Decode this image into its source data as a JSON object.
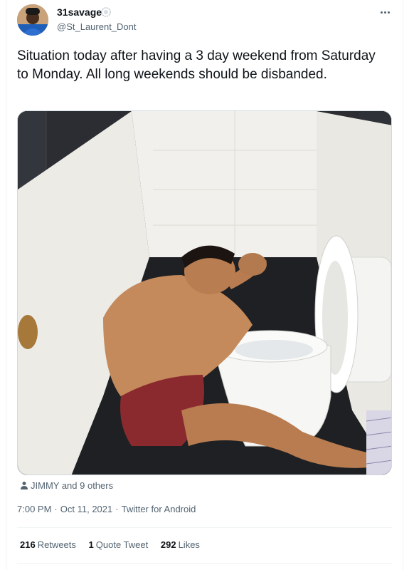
{
  "author": {
    "display_name": "31savage",
    "username": "@St_Laurent_Dont",
    "verified_icon": "badge-icon"
  },
  "tweet": {
    "text": "Situation today after having a 3 day weekend from Saturday to Monday. All long weekends should be disbanded."
  },
  "media": {
    "description_icon": "photo"
  },
  "liked_by": {
    "icon": "person-icon",
    "text": "JIMMY and 9 others"
  },
  "meta": {
    "time": "7:00 PM",
    "separator": "·",
    "date": "Oct 11, 2021",
    "source": "Twitter for Android"
  },
  "stats": {
    "retweets_count": "216",
    "retweets_label": "Retweets",
    "quotes_count": "1",
    "quotes_label": "Quote Tweet",
    "likes_count": "292",
    "likes_label": "Likes"
  },
  "colors": {
    "text_primary": "#0f1419",
    "text_secondary": "#536471",
    "border": "#eff3f4"
  }
}
